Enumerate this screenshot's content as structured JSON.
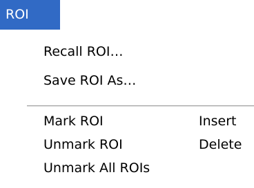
{
  "menu": {
    "title": "ROI",
    "items": [
      {
        "label": "Recall ROI…",
        "shortcut": ""
      },
      {
        "label": "Save ROI As…",
        "shortcut": ""
      },
      {
        "label": "Mark ROI",
        "shortcut": "Insert"
      },
      {
        "label": "Unmark ROI",
        "shortcut": "Delete"
      },
      {
        "label": "Unmark All ROIs",
        "shortcut": ""
      }
    ]
  },
  "colors": {
    "highlight": "#316ac5",
    "highlight_text": "#ffffff",
    "menu_background": "#ffffff",
    "separator": "#a0a0a0"
  }
}
